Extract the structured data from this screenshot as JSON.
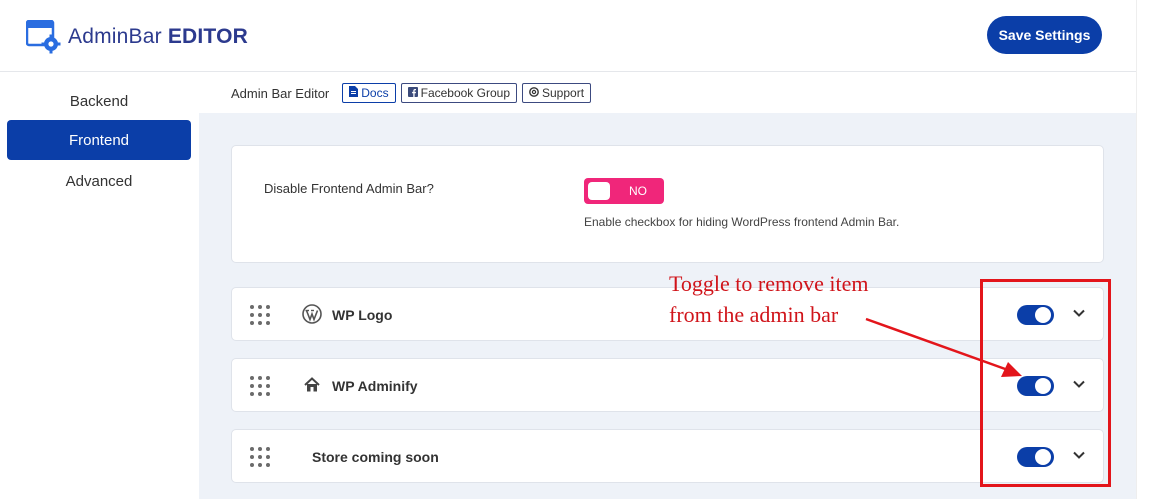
{
  "header": {
    "logo_light": "AdminBar",
    "logo_bold": "EDITOR",
    "save_label": "Save Settings"
  },
  "sidebar": {
    "items": [
      {
        "label": "Backend",
        "active": false
      },
      {
        "label": "Frontend",
        "active": true
      },
      {
        "label": "Advanced",
        "active": false
      }
    ]
  },
  "topbar": {
    "crumb": "Admin Bar Editor",
    "docs": "Docs",
    "facebook": "Facebook Group",
    "support": "Support"
  },
  "settings": {
    "disable_label": "Disable Frontend Admin Bar?",
    "toggle_text": "NO",
    "help": "Enable checkbox for hiding WordPress frontend Admin Bar."
  },
  "rows": [
    {
      "label": "WP Logo",
      "icon": "wordpress-icon",
      "enabled": true
    },
    {
      "label": "WP Adminify",
      "icon": "home-icon",
      "enabled": true
    },
    {
      "label": "Store coming soon",
      "icon": "",
      "enabled": true
    }
  ],
  "annotation": {
    "line1": "Toggle to remove item",
    "line2": "from the admin bar",
    "color": "#e3151b"
  },
  "colors": {
    "primary": "#0b3ea8",
    "toggle_no": "#f0267a",
    "content_bg": "#eef2f8"
  }
}
